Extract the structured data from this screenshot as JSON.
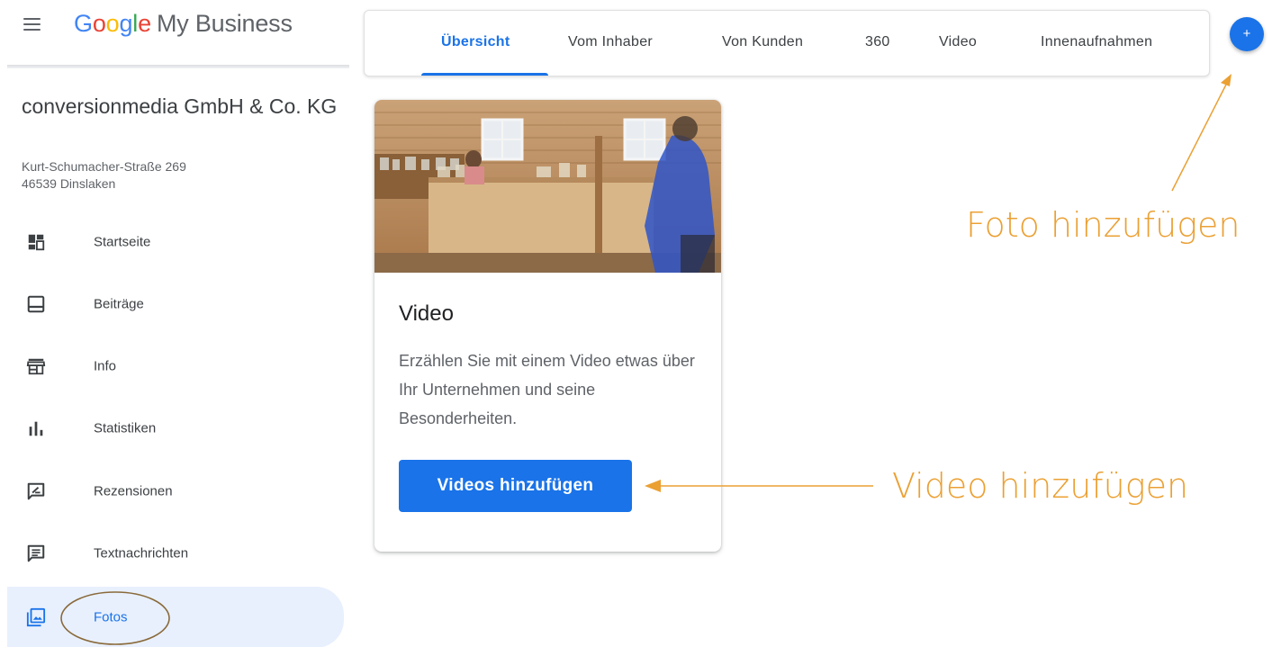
{
  "header": {
    "menu_icon": "hamburger-menu-icon",
    "brand_google": [
      "G",
      "o",
      "o",
      "g",
      "l",
      "e"
    ],
    "brand_colors": [
      "#4285f4",
      "#ea4335",
      "#fbbc05",
      "#4285f4",
      "#34a853",
      "#ea4335"
    ],
    "brand_product": "My Business"
  },
  "business": {
    "name": "conversionmedia GmbH & Co. KG",
    "street": "Kurt-Schumacher-Straße 269",
    "city": "46539 Dinslaken"
  },
  "sidebar": {
    "items": [
      {
        "label": "Startseite",
        "icon": "dashboard-icon",
        "active": false
      },
      {
        "label": "Beiträge",
        "icon": "posts-icon",
        "active": false
      },
      {
        "label": "Info",
        "icon": "storefront-icon",
        "active": false
      },
      {
        "label": "Statistiken",
        "icon": "bar-chart-icon",
        "active": false
      },
      {
        "label": "Rezensionen",
        "icon": "review-icon",
        "active": false
      },
      {
        "label": "Textnachrichten",
        "icon": "message-icon",
        "active": false
      },
      {
        "label": "Fotos",
        "icon": "photo-library-icon",
        "active": true
      }
    ]
  },
  "tabs": [
    {
      "label": "Übersicht",
      "active": true
    },
    {
      "label": "Vom Inhaber",
      "active": false
    },
    {
      "label": "Von Kunden",
      "active": false
    },
    {
      "label": "360",
      "active": false
    },
    {
      "label": "Video",
      "active": false
    },
    {
      "label": "Innenaufnahmen",
      "active": false
    }
  ],
  "add_button": {
    "symbol": "+",
    "icon": "add-icon"
  },
  "card": {
    "title": "Video",
    "description": "Erzählen Sie mit einem Video etwas über Ihr Unternehmen und seine Besonderheiten.",
    "button_label": "Videos hinzufügen"
  },
  "annotations": {
    "foto_label": "Foto hinzufügen",
    "video_label": "Video hinzufügen",
    "color": "#eba033"
  },
  "colors": {
    "accent": "#1a73e8",
    "active_nav_bg": "#e8f0fe",
    "annotation": "#eba033",
    "fotos_circle": "#8a6a3a"
  }
}
